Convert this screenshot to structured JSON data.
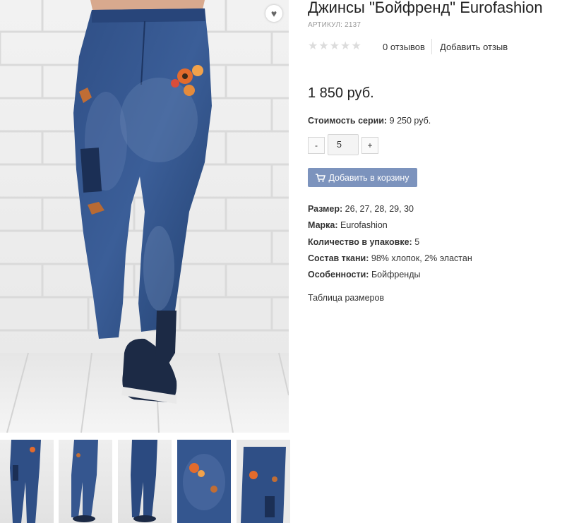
{
  "product": {
    "title": "Джинсы \"Бойфренд\" Eurofashion",
    "sku": "АРТИКУЛ: 2137",
    "rating": {
      "stars": 5,
      "filled": 0
    },
    "reviews_count": "0 отзывов",
    "add_review": "Добавить отзыв",
    "price": "1 850 руб.",
    "series_cost_label": "Стоимость серии:",
    "series_cost_value": "9 250 руб.",
    "quantity": {
      "minus": "-",
      "value": "5",
      "plus": "+"
    },
    "cart_button": "Добавить в корзину",
    "specs": [
      {
        "label": "Размер:",
        "value": "26, 27, 28, 29, 30"
      },
      {
        "label": "Марка:",
        "value": "Eurofashion"
      },
      {
        "label": "Количество в упаковке:",
        "value": "5"
      },
      {
        "label": "Состав ткани:",
        "value": "98% хлопок, 2% эластан"
      },
      {
        "label": "Особенности:",
        "value": "Бойфренды"
      }
    ],
    "size_table_link": "Таблица размеров"
  },
  "gallery": {
    "main_image": "jeans-boyfriend-main-photo",
    "thumbnails": [
      "thumb-1",
      "thumb-2",
      "thumb-3",
      "thumb-4",
      "thumb-5"
    ]
  },
  "icons": {
    "favorite": "heart-icon",
    "cart": "cart-icon",
    "star": "star-icon"
  },
  "colors": {
    "accent_button": "#7c93bd",
    "star_empty": "#dcdcdc",
    "denim": "#2c4a78"
  }
}
